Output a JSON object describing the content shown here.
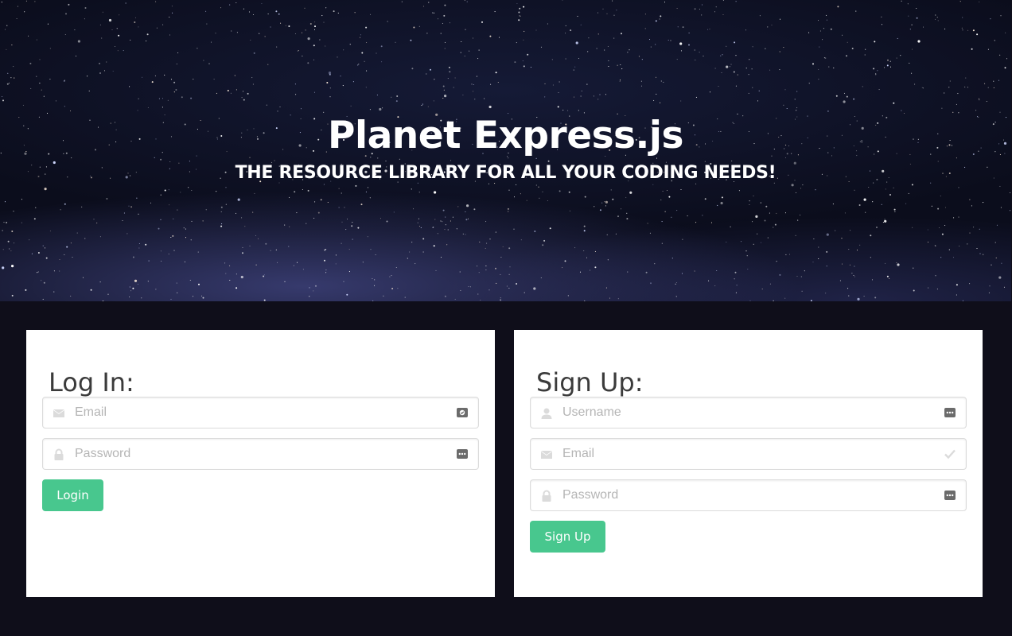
{
  "hero": {
    "title": "Planet Express.js",
    "subtitle": "THE RESOURCE LIBRARY FOR ALL YOUR CODING NEEDS!"
  },
  "login": {
    "heading": "Log In:",
    "email_placeholder": "Email",
    "password_placeholder": "Password",
    "button_label": "Login"
  },
  "signup": {
    "heading": "Sign Up:",
    "username_placeholder": "Username",
    "email_placeholder": "Email",
    "password_placeholder": "Password",
    "button_label": "Sign Up"
  },
  "colors": {
    "page_background": "#0f0e1a",
    "button": "#48c78e",
    "icon": "#dbdbdb"
  },
  "icons": {
    "email": "envelope-icon",
    "password": "lock-icon",
    "username": "user-icon",
    "autofill": "password-manager-icon",
    "valid": "check-icon"
  }
}
